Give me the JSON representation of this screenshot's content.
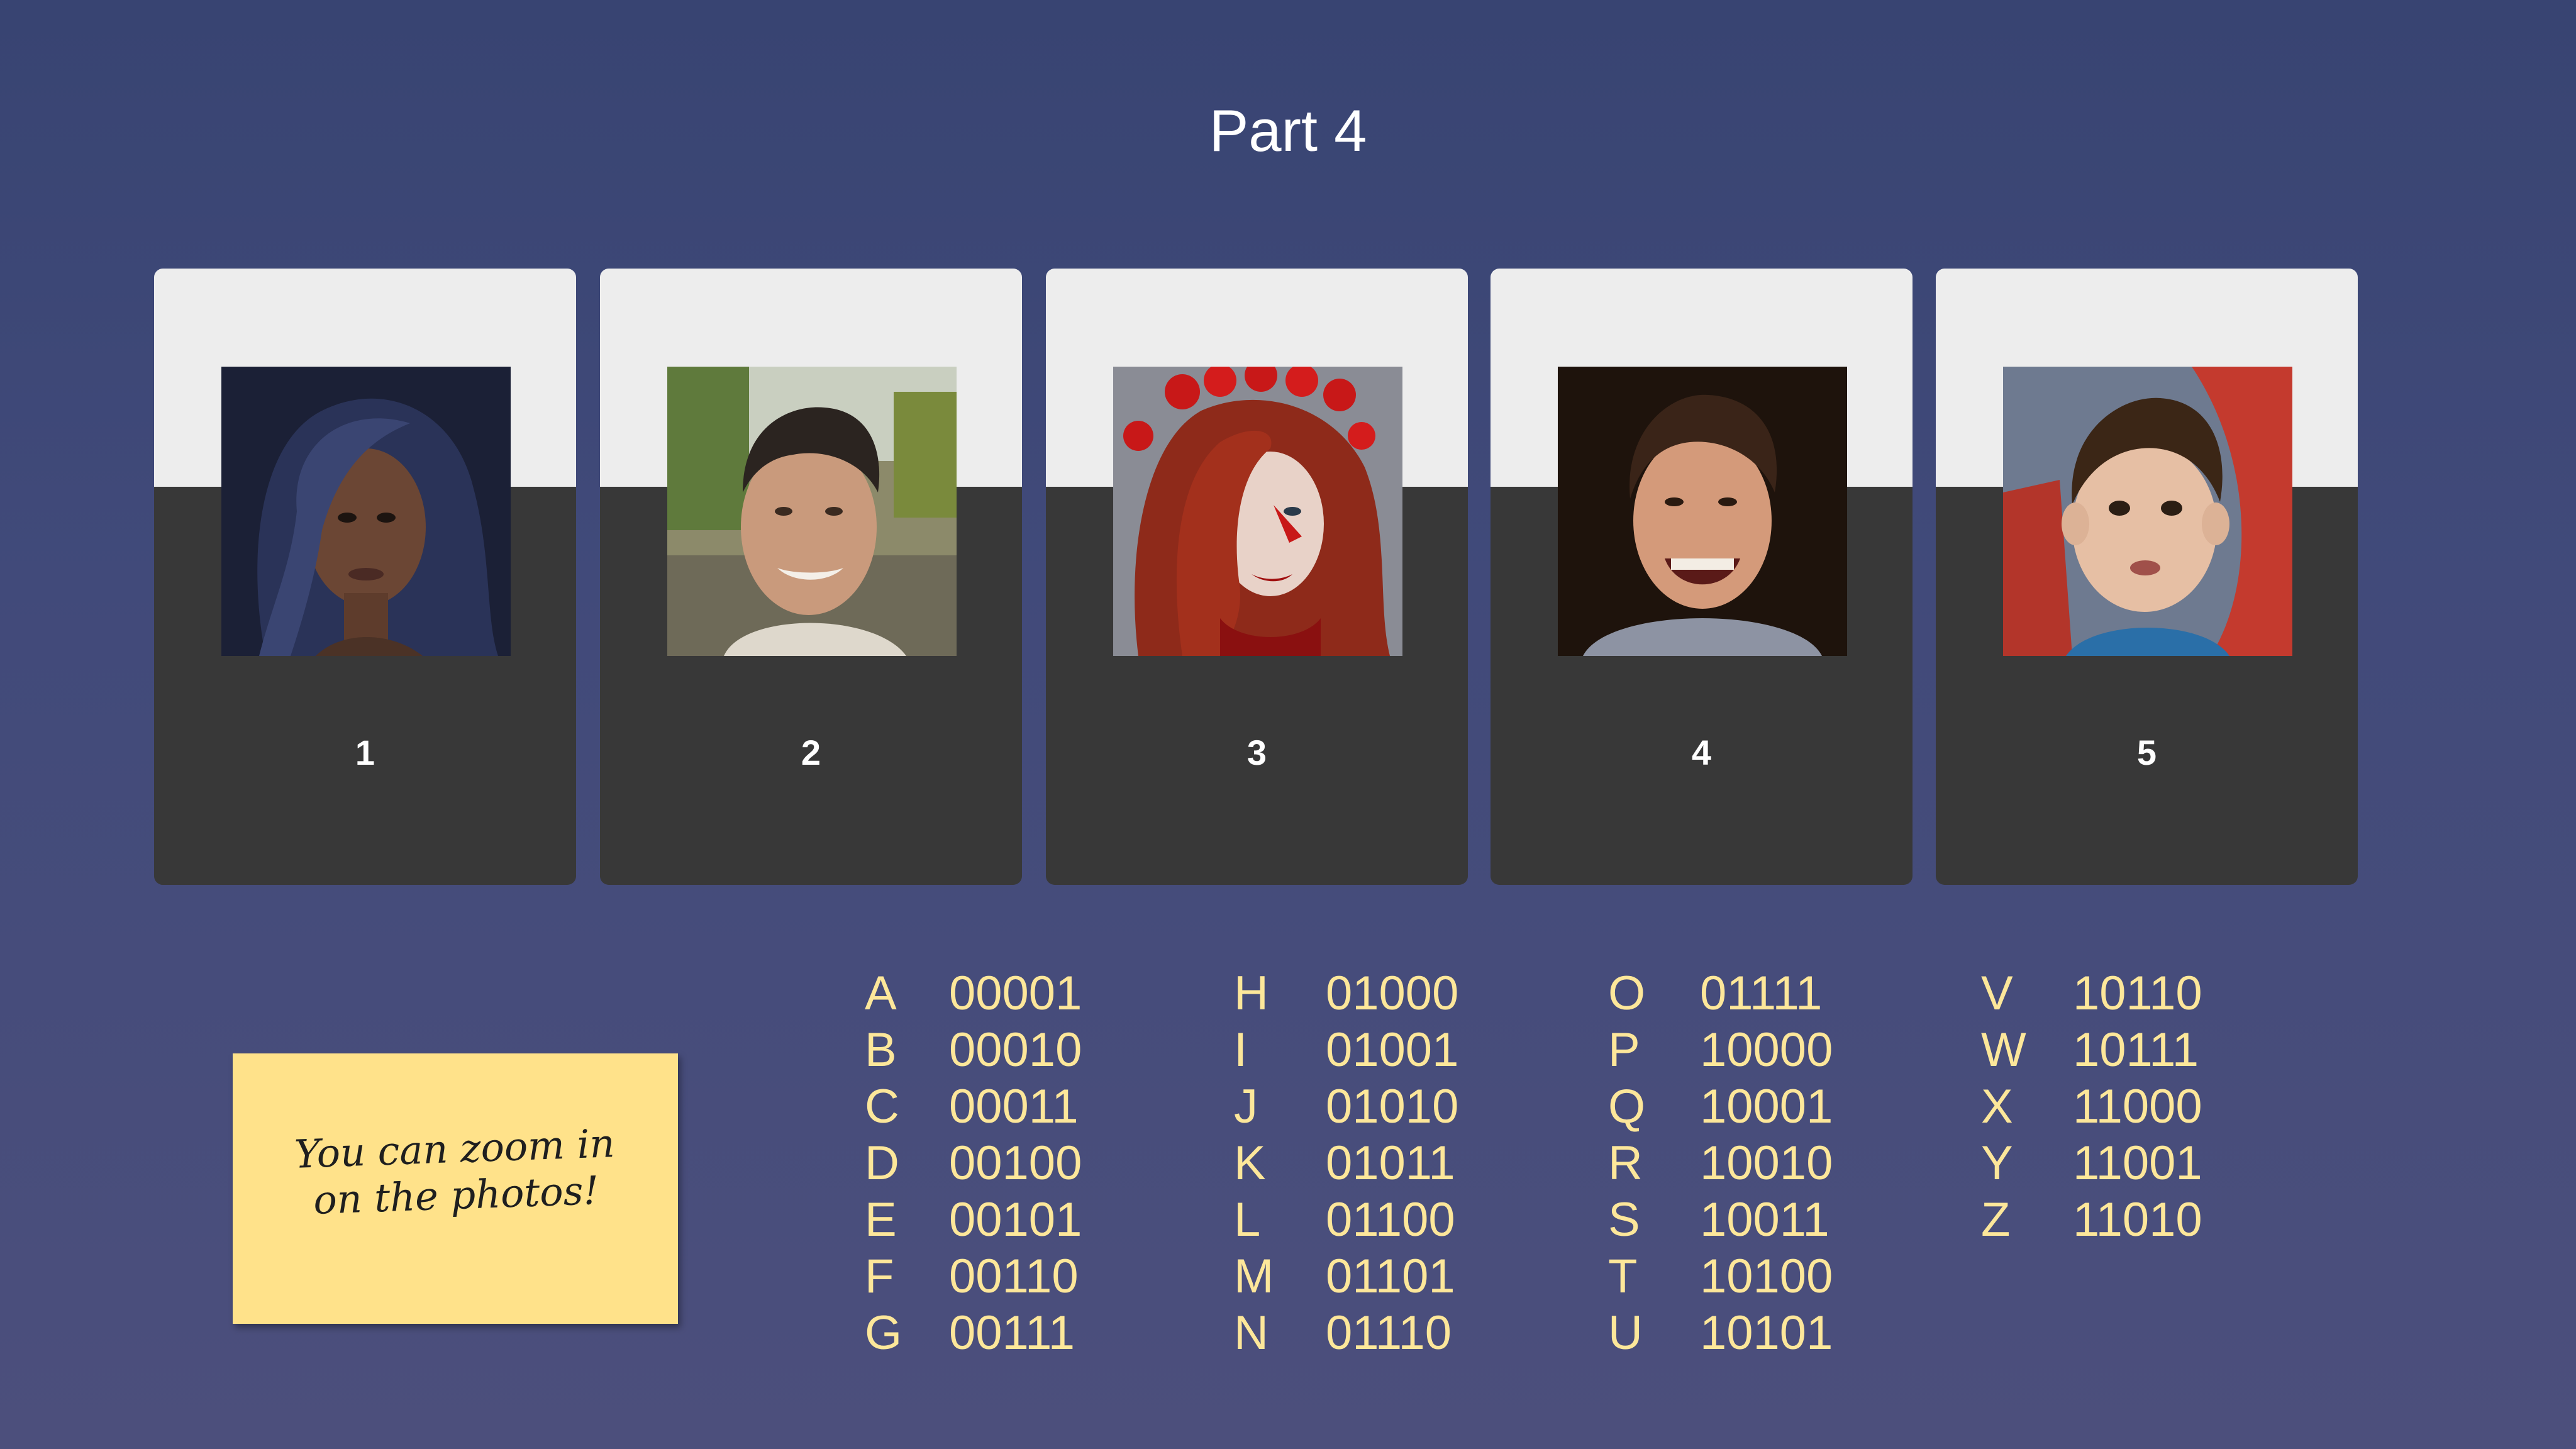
{
  "slide": {
    "title": "Part 4"
  },
  "cards": [
    {
      "number": "1",
      "photo": "portrait-woman-dark-hair-icon"
    },
    {
      "number": "2",
      "photo": "portrait-smiling-man-icon"
    },
    {
      "number": "3",
      "photo": "portrait-woman-red-hair-roses-icon"
    },
    {
      "number": "4",
      "photo": "portrait-laughing-young-man-icon"
    },
    {
      "number": "5",
      "photo": "portrait-young-boy-icon"
    }
  ],
  "note": {
    "line1": "You can zoom in",
    "line2": "on the photos!"
  },
  "code_table": [
    [
      {
        "letter": "A",
        "bits": "00001"
      },
      {
        "letter": "B",
        "bits": "00010"
      },
      {
        "letter": "C",
        "bits": "00011"
      },
      {
        "letter": "D",
        "bits": "00100"
      },
      {
        "letter": "E",
        "bits": "00101"
      },
      {
        "letter": "F",
        "bits": "00110"
      },
      {
        "letter": "G",
        "bits": "00111"
      }
    ],
    [
      {
        "letter": "H",
        "bits": "01000"
      },
      {
        "letter": "I",
        "bits": "01001"
      },
      {
        "letter": "J",
        "bits": "01010"
      },
      {
        "letter": "K",
        "bits": "01011"
      },
      {
        "letter": "L",
        "bits": "01100"
      },
      {
        "letter": "M",
        "bits": "01101"
      },
      {
        "letter": "N",
        "bits": "01110"
      }
    ],
    [
      {
        "letter": "O",
        "bits": "01111"
      },
      {
        "letter": "P",
        "bits": "10000"
      },
      {
        "letter": "Q",
        "bits": "10001"
      },
      {
        "letter": "R",
        "bits": "10010"
      },
      {
        "letter": "S",
        "bits": "10011"
      },
      {
        "letter": "T",
        "bits": "10100"
      },
      {
        "letter": "U",
        "bits": "10101"
      }
    ],
    [
      {
        "letter": "V",
        "bits": "10110"
      },
      {
        "letter": "W",
        "bits": "10111"
      },
      {
        "letter": "X",
        "bits": "11000"
      },
      {
        "letter": "Y",
        "bits": "11001"
      },
      {
        "letter": "Z",
        "bits": "11010"
      }
    ]
  ],
  "colors": {
    "background": "#3d4676",
    "card_top": "#ededed",
    "card_bottom": "#383838",
    "code_text": "#fde79a",
    "note": "#ffe28a"
  }
}
